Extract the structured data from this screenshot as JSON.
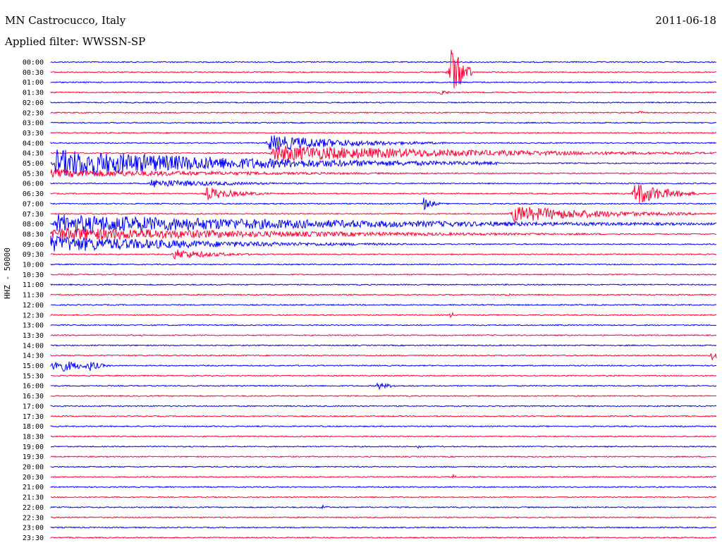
{
  "header": {
    "station": "MN Castrocucco, Italy",
    "filter": "Applied filter: WWSSN-SP",
    "date": "2011-06-18"
  },
  "chart_data": {
    "type": "line",
    "title": "MN Castrocucco, Italy",
    "subtitle": "Applied filter: WWSSN-SP",
    "ylabel": "HHZ - 50000",
    "colors": [
      "#0000ff",
      "#ff0033"
    ],
    "rows": [
      "00:00",
      "00:30",
      "01:00",
      "01:30",
      "02:00",
      "02:30",
      "03:00",
      "03:30",
      "04:00",
      "04:30",
      "05:00",
      "05:30",
      "06:00",
      "06:30",
      "07:00",
      "07:30",
      "08:00",
      "08:30",
      "09:00",
      "09:30",
      "10:00",
      "10:30",
      "11:00",
      "11:30",
      "12:00",
      "12:30",
      "13:00",
      "13:30",
      "14:00",
      "14:30",
      "15:00",
      "15:30",
      "16:00",
      "16:30",
      "17:00",
      "17:30",
      "18:00",
      "18:30",
      "19:00",
      "19:30",
      "20:00",
      "20:30",
      "21:00",
      "21:30",
      "22:00",
      "22:30",
      "23:00",
      "23:30"
    ],
    "events": [
      {
        "row": "00:30",
        "minute": 18.0,
        "amplitude": 45,
        "duration": 1.0
      },
      {
        "row": "01:30",
        "minute": 17.5,
        "amplitude": 6,
        "duration": 0.6
      },
      {
        "row": "02:30",
        "minute": 26.5,
        "amplitude": 3,
        "duration": 0.4
      },
      {
        "row": "04:00",
        "minute": 9.8,
        "amplitude": 12,
        "duration": 8.0
      },
      {
        "row": "04:30",
        "minute": 10.0,
        "amplitude": 12,
        "duration": 20.0
      },
      {
        "row": "05:00",
        "minute": 0.2,
        "amplitude": 20,
        "duration": 20.0
      },
      {
        "row": "05:30",
        "minute": 0.0,
        "amplitude": 6,
        "duration": 20.0
      },
      {
        "row": "06:00",
        "minute": 4.5,
        "amplitude": 6,
        "duration": 8.0
      },
      {
        "row": "06:30",
        "minute": 7.0,
        "amplitude": 10,
        "duration": 3.0
      },
      {
        "row": "06:30",
        "minute": 26.3,
        "amplitude": 18,
        "duration": 3.0
      },
      {
        "row": "07:00",
        "minute": 16.8,
        "amplitude": 10,
        "duration": 0.8
      },
      {
        "row": "07:30",
        "minute": 20.8,
        "amplitude": 12,
        "duration": 9.0
      },
      {
        "row": "08:00",
        "minute": 0.2,
        "amplitude": 14,
        "duration": 30.0
      },
      {
        "row": "08:30",
        "minute": 0.0,
        "amplitude": 10,
        "duration": 25.0
      },
      {
        "row": "09:00",
        "minute": 0.0,
        "amplitude": 12,
        "duration": 16.0
      },
      {
        "row": "09:30",
        "minute": 5.5,
        "amplitude": 8,
        "duration": 4.0
      },
      {
        "row": "11:30",
        "minute": 20.5,
        "amplitude": 4,
        "duration": 0.4
      },
      {
        "row": "12:30",
        "minute": 18.0,
        "amplitude": 6,
        "duration": 0.3
      },
      {
        "row": "14:30",
        "minute": 29.8,
        "amplitude": 12,
        "duration": 0.3
      },
      {
        "row": "15:00",
        "minute": 0.1,
        "amplitude": 12,
        "duration": 2.5
      },
      {
        "row": "15:00",
        "minute": 1.7,
        "amplitude": 9,
        "duration": 1.0
      },
      {
        "row": "16:00",
        "minute": 14.7,
        "amplitude": 6,
        "duration": 1.2
      },
      {
        "row": "19:00",
        "minute": 16.5,
        "amplitude": 5,
        "duration": 0.3
      },
      {
        "row": "20:30",
        "minute": 18.1,
        "amplitude": 4,
        "duration": 0.3
      },
      {
        "row": "22:00",
        "minute": 12.2,
        "amplitude": 6,
        "duration": 0.3
      }
    ]
  }
}
